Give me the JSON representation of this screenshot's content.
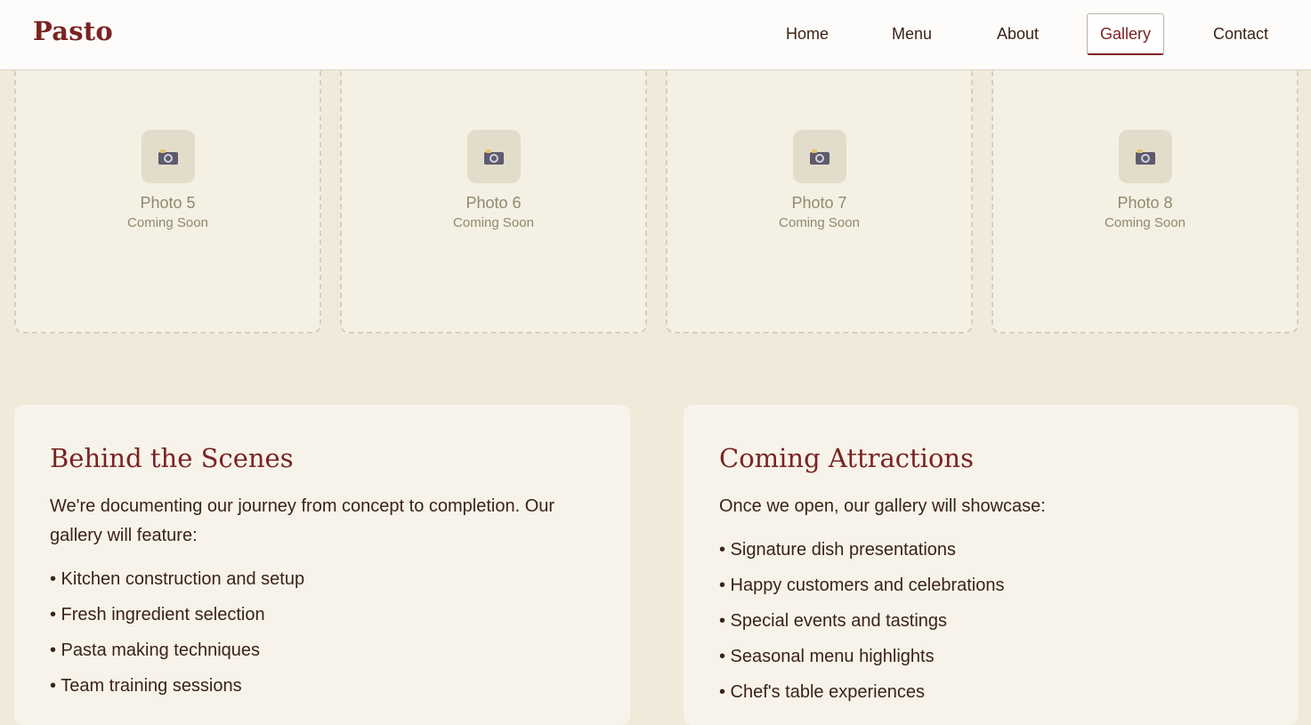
{
  "header": {
    "brand": "Pasto",
    "nav": [
      {
        "label": "Home"
      },
      {
        "label": "Menu"
      },
      {
        "label": "About"
      },
      {
        "label": "Gallery",
        "active": true
      },
      {
        "label": "Contact"
      }
    ]
  },
  "gallery": {
    "photos": [
      {
        "title": "Photo 5",
        "subtitle": "Coming Soon",
        "icon": "camera-icon"
      },
      {
        "title": "Photo 6",
        "subtitle": "Coming Soon",
        "icon": "camera-icon"
      },
      {
        "title": "Photo 7",
        "subtitle": "Coming Soon",
        "icon": "camera-icon"
      },
      {
        "title": "Photo 8",
        "subtitle": "Coming Soon",
        "icon": "camera-icon"
      }
    ]
  },
  "behind_scenes": {
    "title": "Behind the Scenes",
    "intro": "We're documenting our journey from concept to completion. Our gallery will feature:",
    "items": [
      "• Kitchen construction and setup",
      "• Fresh ingredient selection",
      "• Pasta making techniques",
      "• Team training sessions"
    ]
  },
  "coming_attractions": {
    "title": "Coming Attractions",
    "intro": "Once we open, our gallery will showcase:",
    "items": [
      "• Signature dish presentations",
      "• Happy customers and celebrations",
      "• Special events and tastings",
      "• Seasonal menu highlights",
      "• Chef's table experiences"
    ]
  },
  "colors": {
    "brand": "#7a2323",
    "background": "#f0eadb",
    "text": "#3b2316",
    "muted": "#8e8a6f"
  }
}
